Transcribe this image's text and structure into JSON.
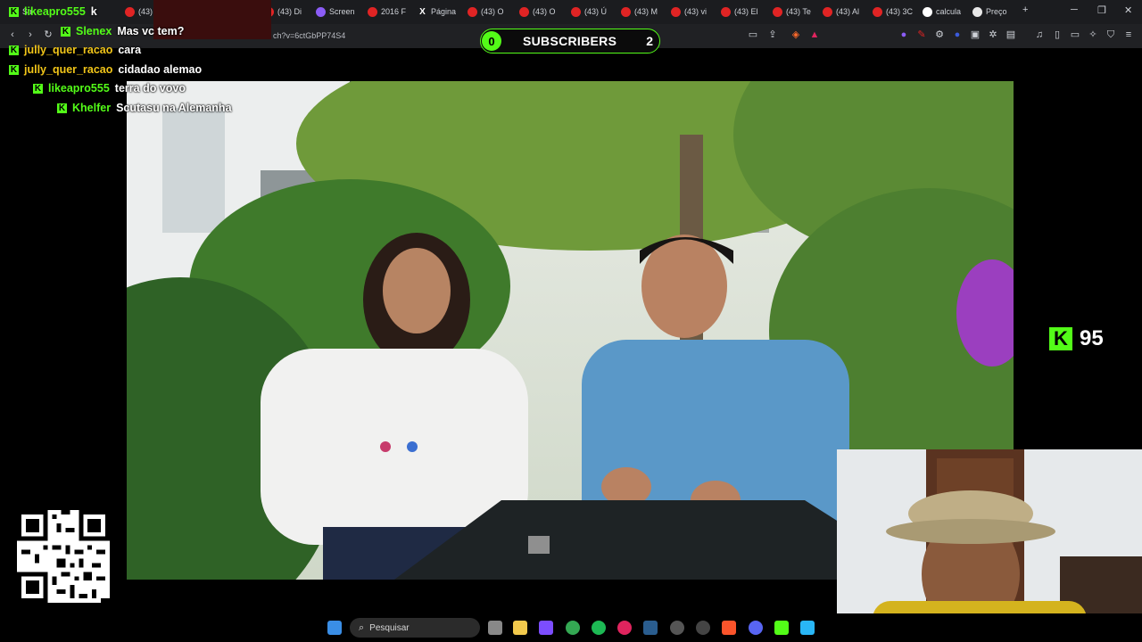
{
  "browser": {
    "tabs": [
      {
        "label": "Str",
        "icon": "kick-icon"
      },
      {
        "label": "(43) Pl",
        "icon": "youtube-icon"
      },
      {
        "label": "(43) Di",
        "icon": "youtube-icon"
      },
      {
        "label": "Screen",
        "icon": "pen-icon"
      },
      {
        "label": "2016 F",
        "icon": "youtube-icon"
      },
      {
        "label": "Página",
        "icon": "x-icon"
      },
      {
        "label": "(43) O",
        "icon": "youtube-icon"
      },
      {
        "label": "(43) O",
        "icon": "youtube-icon"
      },
      {
        "label": "(43) Ú",
        "icon": "youtube-icon"
      },
      {
        "label": "(43) M",
        "icon": "youtube-icon"
      },
      {
        "label": "(43) vi",
        "icon": "youtube-icon"
      },
      {
        "label": "(43) El",
        "icon": "youtube-icon"
      },
      {
        "label": "(43) Te",
        "icon": "youtube-icon"
      },
      {
        "label": "(43) Al",
        "icon": "youtube-icon"
      },
      {
        "label": "(43) 3C",
        "icon": "youtube-icon"
      },
      {
        "label": "calcula",
        "icon": "google-icon"
      },
      {
        "label": "Preço",
        "icon": "globe-icon"
      }
    ],
    "url": "ch?v=6ctGbPP74S4"
  },
  "chat": [
    {
      "user": "likeapro555",
      "message": "k",
      "user_color": "#53fc18"
    },
    {
      "user": "Slenex",
      "message": "Mas vc tem?",
      "user_color": "#53fc18"
    },
    {
      "user": "jully_quer_racao",
      "message": "cara",
      "user_color": "#f0c419"
    },
    {
      "user": "jully_quer_racao",
      "message": "cidadao alemao",
      "user_color": "#f0c419"
    },
    {
      "user": "likeapro555",
      "message": "terra do vovo",
      "user_color": "#53fc18"
    },
    {
      "user": "Khelfer",
      "message": "Scutasu na Alemanha",
      "user_color": "#53fc18"
    }
  ],
  "subscribers": {
    "left_count": "0",
    "label": "SUBSCRIBERS",
    "right_count": "2"
  },
  "kick_counter": {
    "value": "95"
  },
  "taskbar": {
    "search_placeholder": "Pesquisar"
  },
  "colors": {
    "kick_green": "#53fc18",
    "chat_yellow": "#f0c419"
  }
}
